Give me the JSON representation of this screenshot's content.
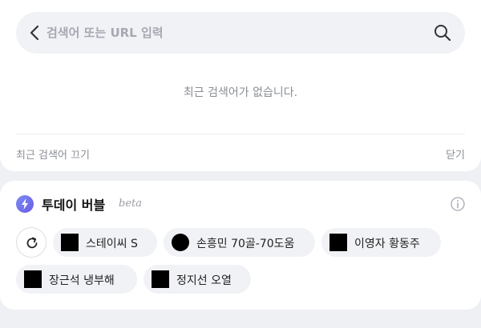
{
  "search": {
    "placeholder": "검색어 또는 URL 입력",
    "value": ""
  },
  "recent": {
    "empty_message": "최근 검색어가 없습니다.",
    "toggle_label": "최근 검색어 끄기",
    "close_label": "닫기"
  },
  "bubble": {
    "title": "투데이 버블",
    "badge": "beta",
    "accent": "#6a5be8",
    "chips": [
      {
        "label": "스테이씨 S"
      },
      {
        "label": "손흥민 70골-70도움"
      },
      {
        "label": "이영자 황동주"
      },
      {
        "label": "장근석 냉부해"
      },
      {
        "label": "정지선 오열"
      }
    ]
  },
  "icons": {
    "back": "chevron-left-icon",
    "search": "search-icon",
    "bubble": "lightning-icon",
    "info": "info-icon",
    "refresh": "refresh-icon"
  }
}
